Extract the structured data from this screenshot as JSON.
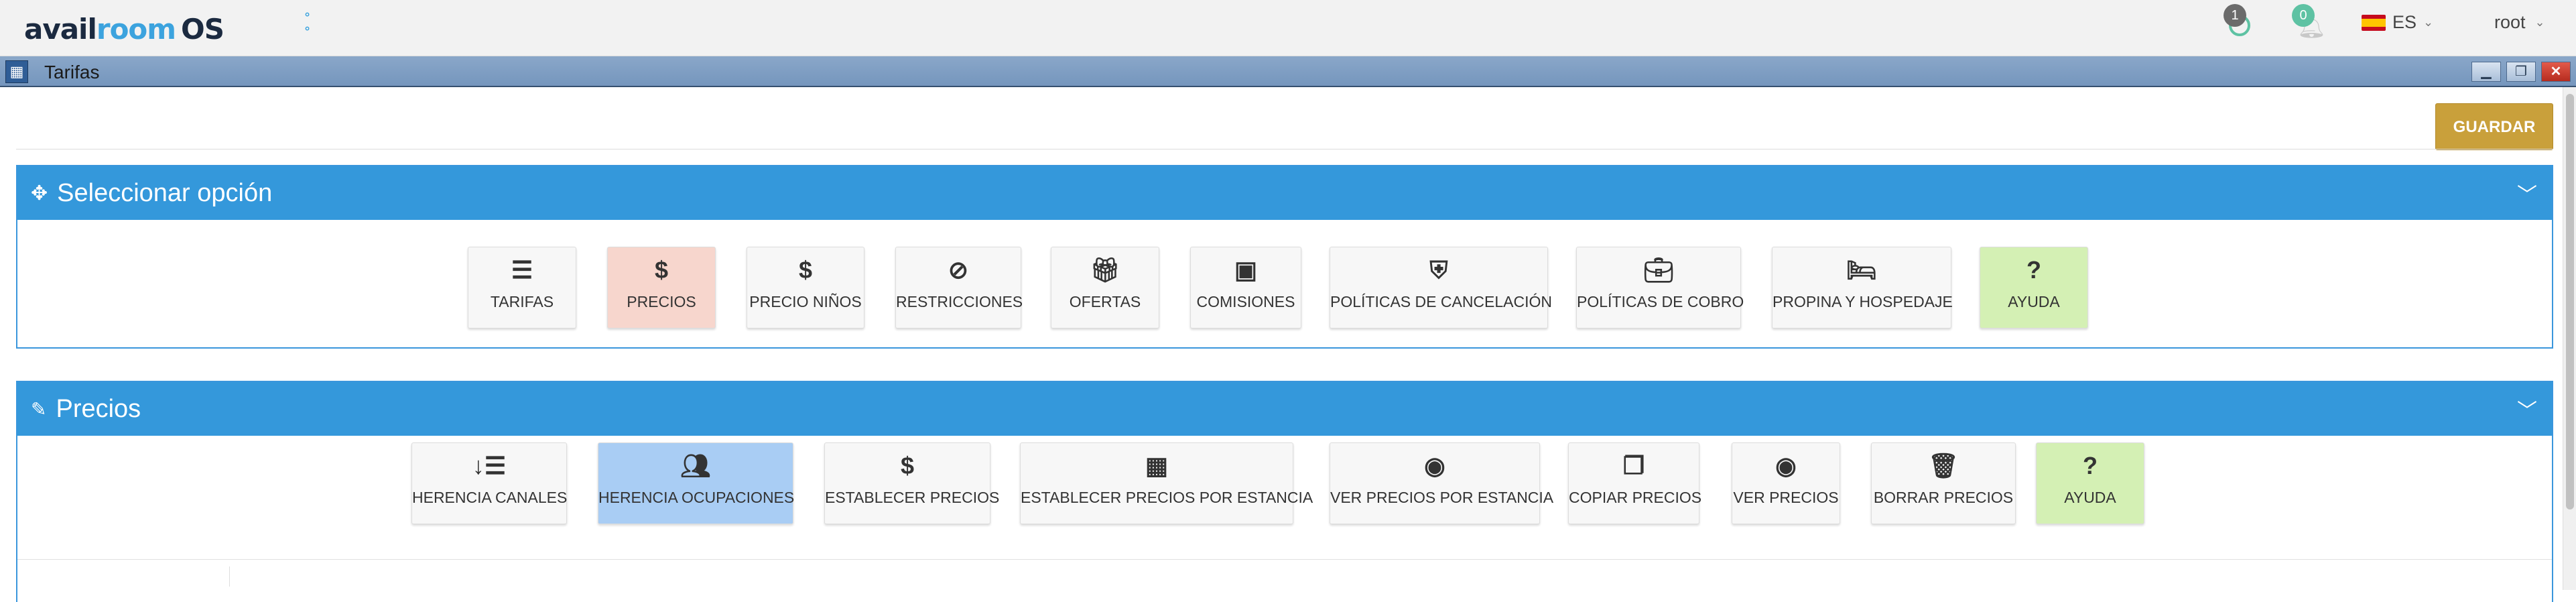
{
  "header": {
    "logo_part1": "avail",
    "logo_part2": "room",
    "logo_part3": "OS",
    "messages_count": "1",
    "notifications_count": "0",
    "language": "ES",
    "user": "root"
  },
  "window": {
    "title": "Tarifas"
  },
  "toolbar": {
    "save_label": "GUARDAR"
  },
  "select_panel": {
    "title": "Seleccionar opción",
    "options": [
      {
        "label": "TARIFAS",
        "icon": "list-icon"
      },
      {
        "label": "PRECIOS",
        "icon": "dollar-icon"
      },
      {
        "label": "PRECIO NIÑOS",
        "icon": "dollar-icon"
      },
      {
        "label": "RESTRICCIONES",
        "icon": "ban-icon"
      },
      {
        "label": "OFERTAS",
        "icon": "gift-icon"
      },
      {
        "label": "COMISIONES",
        "icon": "money-icon"
      },
      {
        "label": "POLÍTICAS DE CANCELACIÓN",
        "icon": "shield-icon"
      },
      {
        "label": "POLÍTICAS DE COBRO",
        "icon": "briefcase-icon"
      },
      {
        "label": "PROPINA Y HOSPEDAJE",
        "icon": "bed-icon"
      },
      {
        "label": "AYUDA",
        "icon": "question-icon"
      }
    ]
  },
  "prices_panel": {
    "title": "Precios",
    "options": [
      {
        "label": "HERENCIA CANALES",
        "icon": "sort-icon"
      },
      {
        "label": "HERENCIA OCUPACIONES",
        "icon": "users-icon"
      },
      {
        "label": "ESTABLECER PRECIOS",
        "icon": "dollar-icon"
      },
      {
        "label": "ESTABLECER PRECIOS POR ESTANCIA",
        "icon": "calendar-icon"
      },
      {
        "label": "VER PRECIOS POR ESTANCIA",
        "icon": "eye-icon"
      },
      {
        "label": "COPIAR PRECIOS",
        "icon": "copy-icon"
      },
      {
        "label": "VER PRECIOS",
        "icon": "eye-icon"
      },
      {
        "label": "BORRAR PRECIOS",
        "icon": "trash-icon"
      },
      {
        "label": "AYUDA",
        "icon": "question-icon"
      }
    ]
  },
  "colors": {
    "panel_header": "#3498db",
    "save_button": "#c9a03b",
    "selected_option": "#f7d6cd",
    "help_option": "#d4f0b4",
    "active_option": "#a9cdf4"
  }
}
